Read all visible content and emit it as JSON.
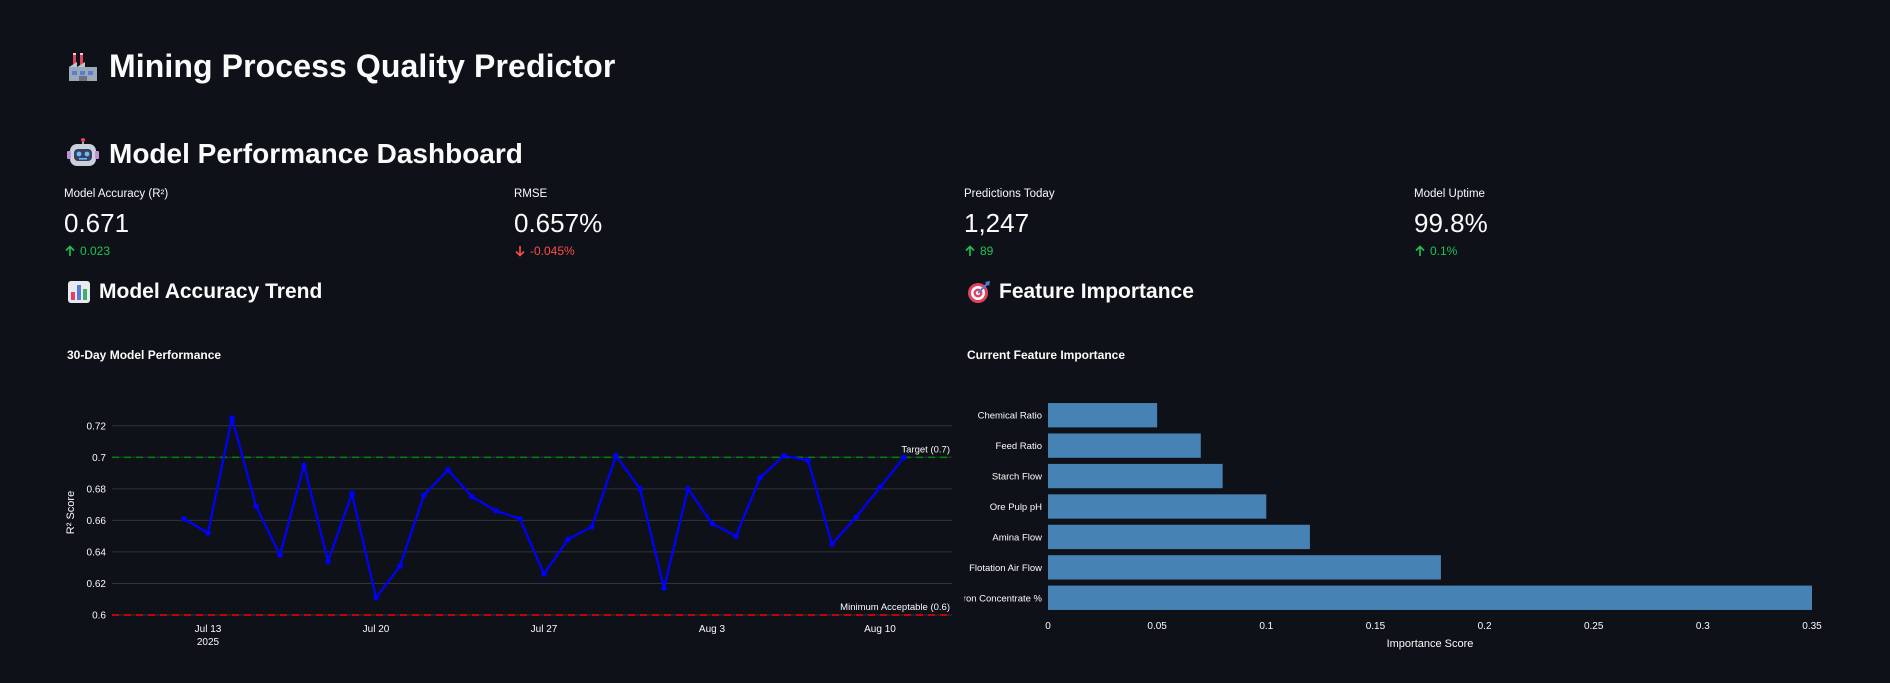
{
  "header": {
    "title": "Mining Process Quality Predictor",
    "section_title": "Model Performance Dashboard"
  },
  "metrics": [
    {
      "label": "Model Accuracy (R²)",
      "value": "0.671",
      "delta": "0.023",
      "direction": "up"
    },
    {
      "label": "RMSE",
      "value": "0.657%",
      "delta": "-0.045%",
      "direction": "down"
    },
    {
      "label": "Predictions Today",
      "value": "1,247",
      "delta": "89",
      "direction": "up"
    },
    {
      "label": "Model Uptime",
      "value": "99.8%",
      "delta": "0.1%",
      "direction": "up"
    }
  ],
  "colors": {
    "background": "#0e1117",
    "text": "#fafafa",
    "delta_up": "#21c354",
    "delta_down": "#ff4b4b",
    "line_series": "#0000ff",
    "target_line": "#008000",
    "min_line": "#ff0000",
    "bar_fill": "#4682b4",
    "grid": "#30343c"
  },
  "icons": {
    "app": "factory-icon",
    "section": "robot-icon",
    "trend": "bar-chart-icon",
    "features": "target-icon",
    "delta_up": "arrow-up-icon",
    "delta_down": "arrow-down-icon"
  },
  "sections": {
    "trend_title": "Model Accuracy Trend",
    "features_title": "Feature Importance"
  },
  "chart_data": [
    {
      "type": "line",
      "title": "30-Day Model Performance",
      "xlabel": "",
      "ylabel": "R² Score",
      "x": [
        "2025-07-12",
        "2025-07-13",
        "2025-07-14",
        "2025-07-15",
        "2025-07-16",
        "2025-07-17",
        "2025-07-18",
        "2025-07-19",
        "2025-07-20",
        "2025-07-21",
        "2025-07-22",
        "2025-07-23",
        "2025-07-24",
        "2025-07-25",
        "2025-07-26",
        "2025-07-27",
        "2025-07-28",
        "2025-07-29",
        "2025-07-30",
        "2025-07-31",
        "2025-08-01",
        "2025-08-02",
        "2025-08-03",
        "2025-08-04",
        "2025-08-05",
        "2025-08-06",
        "2025-08-07",
        "2025-08-08",
        "2025-08-09",
        "2025-08-10",
        "2025-08-11"
      ],
      "series": [
        {
          "values": [
            0.661,
            0.652,
            0.725,
            0.669,
            0.638,
            0.695,
            0.634,
            0.677,
            0.611,
            0.631,
            0.676,
            0.692,
            0.675,
            0.666,
            0.661,
            0.626,
            0.648,
            0.656,
            0.701,
            0.68,
            0.617,
            0.68,
            0.658,
            0.65,
            0.687,
            0.701,
            0.698,
            0.645,
            0.662,
            0.681,
            0.7
          ]
        }
      ],
      "ylim": [
        0.6,
        0.73
      ],
      "yticks": [
        "0.6",
        "0.62",
        "0.64",
        "0.66",
        "0.68",
        "0.7",
        "0.72"
      ],
      "xticks": [
        {
          "date": "2025-07-13",
          "label": "Jul 13",
          "sublabel": "2025"
        },
        {
          "date": "2025-07-20",
          "label": "Jul 20"
        },
        {
          "date": "2025-07-27",
          "label": "Jul 27"
        },
        {
          "date": "2025-08-03",
          "label": "Aug 3"
        },
        {
          "date": "2025-08-10",
          "label": "Aug 10"
        }
      ],
      "xrange": [
        "2025-07-09",
        "2025-08-13"
      ],
      "grid": true,
      "reference_lines": [
        {
          "y": 0.7,
          "label": "Target (0.7)",
          "color": "#008000",
          "style": "dashed"
        },
        {
          "y": 0.6,
          "label": "Minimum Acceptable (0.6)",
          "color": "#ff0000",
          "style": "dashed"
        }
      ]
    },
    {
      "type": "bar",
      "orientation": "horizontal",
      "title": "Current Feature Importance",
      "xlabel": "Importance Score",
      "ylabel": "",
      "categories": [
        "Chemical Ratio",
        "Feed Ratio",
        "Starch Flow",
        "Ore Pulp pH",
        "Amina Flow",
        "Flotation Air Flow",
        "Iron Concentrate %"
      ],
      "values": [
        0.05,
        0.07,
        0.08,
        0.1,
        0.12,
        0.18,
        0.35
      ],
      "xlim": [
        0,
        0.35
      ],
      "xticks": [
        "0",
        "0.05",
        "0.1",
        "0.15",
        "0.2",
        "0.25",
        "0.3",
        "0.35"
      ],
      "grid": false
    }
  ]
}
